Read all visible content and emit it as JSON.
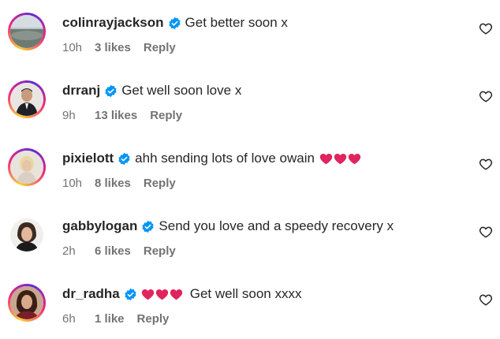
{
  "comments": [
    {
      "username": "colinrayjackson",
      "text": "Get better soon x",
      "time": "10h",
      "likes": "3 likes",
      "reply": "Reply",
      "hearts": 0,
      "text_after_hearts": ""
    },
    {
      "username": "drranj",
      "text": "Get well soon love x",
      "time": "9h",
      "likes": "13 likes",
      "reply": "Reply",
      "hearts": 0,
      "text_after_hearts": ""
    },
    {
      "username": "pixielott",
      "text": "ahh sending lots of love owain",
      "time": "10h",
      "likes": "8 likes",
      "reply": "Reply",
      "hearts": 3,
      "text_after_hearts": ""
    },
    {
      "username": "gabbylogan",
      "text": "Send you love and a speedy recovery x",
      "time": "2h",
      "likes": "6 likes",
      "reply": "Reply",
      "hearts": 0,
      "text_after_hearts": ""
    },
    {
      "username": "dr_radha",
      "text": "",
      "time": "6h",
      "likes": "1 like",
      "reply": "Reply",
      "hearts": 3,
      "text_after_hearts": "Get well soon xxxx"
    }
  ],
  "colors": {
    "verified": "#0095f6",
    "heart_emoji": "#e0245e",
    "meta_text": "#737373"
  },
  "icons": {
    "verified": "verified-badge-icon",
    "like": "heart-outline-icon",
    "emoji": "red-heart-emoji"
  }
}
